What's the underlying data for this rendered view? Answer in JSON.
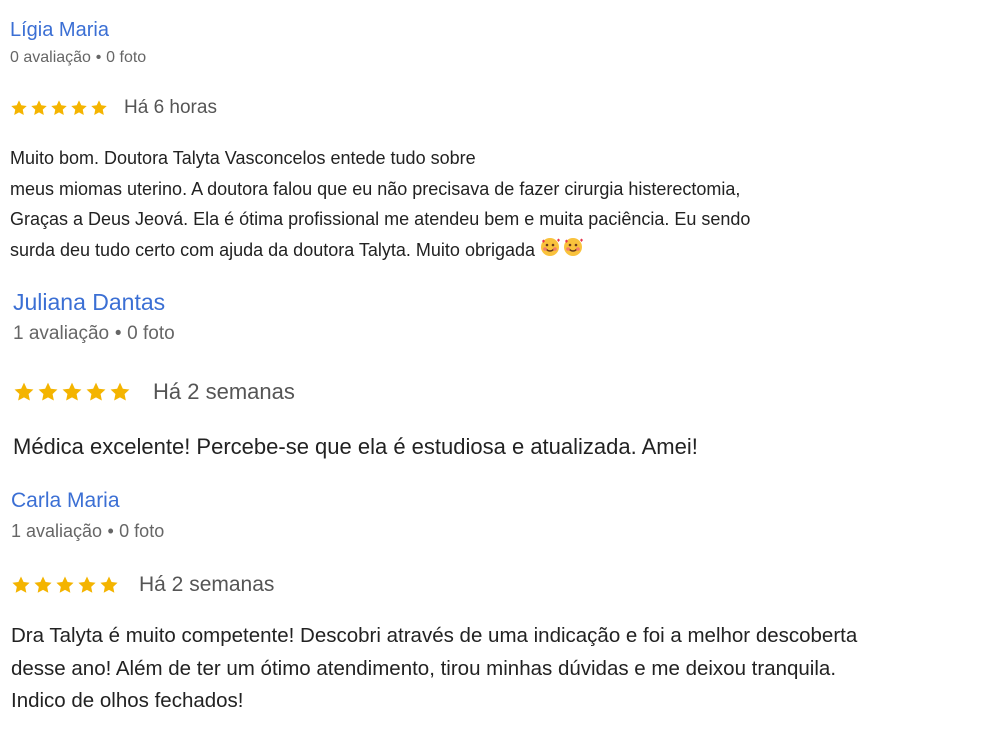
{
  "reviews": [
    {
      "name": "Lígia Maria",
      "reviews_count": "0 avaliação",
      "separator": "•",
      "photos_count": "0 foto",
      "rating": 5,
      "time_ago": "Há 6 horas",
      "text_lines": [
        "Muito bom. Doutora Talyta Vasconcelos entede tudo sobre",
        "meus miomas uterino. A doutora falou que eu não precisava de fazer cirurgia histerectomia,",
        "Graças a Deus Jeová. Ela é ótima profissional me atendeu bem e muita paciência. Eu sendo",
        "surda deu tudo certo com ajuda da doutora Talyta. Muito obrigada"
      ],
      "emoji": "🥰🥰"
    },
    {
      "name": "Juliana Dantas",
      "reviews_count": "1 avaliação",
      "separator": "•",
      "photos_count": "0 foto",
      "rating": 5,
      "time_ago": "Há 2 semanas",
      "text_lines": [
        "Médica excelente! Percebe-se que ela é estudiosa e atualizada. Amei!"
      ]
    },
    {
      "name": "Carla Maria",
      "reviews_count": "1 avaliação",
      "separator": "•",
      "photos_count": "0 foto",
      "rating": 5,
      "time_ago": "Há 2 semanas",
      "text_lines": [
        "Dra Talyta é muito competente! Descobri através de uma indicação e foi a melhor descoberta",
        "desse ano! Além de ter um ótimo atendimento, tirou minhas dúvidas e me deixou tranquila.",
        "Indico de olhos fechados!"
      ]
    }
  ],
  "colors": {
    "name": "#3b6fd4",
    "star": "#f4b400",
    "meta": "#666666",
    "text": "#222222"
  },
  "icons": {
    "star": "star-icon",
    "emoji": "smiling-face-with-hearts-emoji"
  }
}
